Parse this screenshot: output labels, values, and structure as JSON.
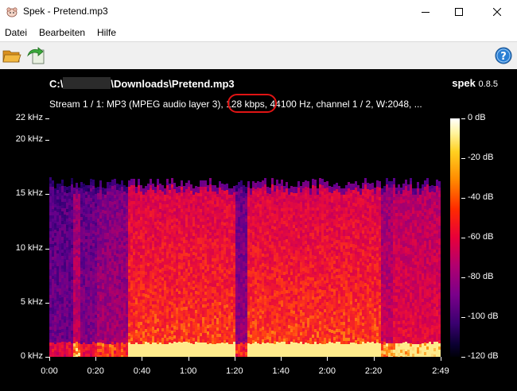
{
  "window": {
    "title": "Spek - Pretend.mp3",
    "icons": {
      "app": "spek-app-icon",
      "minimize": "minimize-icon",
      "maximize": "maximize-icon",
      "close": "close-icon"
    }
  },
  "menu": {
    "items": [
      {
        "label": "Datei"
      },
      {
        "label": "Bearbeiten"
      },
      {
        "label": "Hilfe"
      }
    ]
  },
  "toolbar": {
    "open_icon": "folder-open-icon",
    "save_icon": "save-image-icon",
    "help_icon": "help-icon"
  },
  "viewer": {
    "path_prefix": "C:\\",
    "path_suffix": "\\Downloads\\Pretend.mp3",
    "brand_name": "spek",
    "brand_version": "0.8.5",
    "stream_before": "Stream 1 / 1: MP3 (MPEG audio layer 3), ",
    "stream_bitrate": "128 kbps",
    "stream_after": ", 44100 Hz, channel 1 / 2, W:2048, ...",
    "highlight_color": "#e01414"
  },
  "chart_data": {
    "type": "heatmap",
    "title": "",
    "y_axis": {
      "ticks": [
        "22 kHz",
        "20 kHz",
        "15 kHz",
        "10 kHz",
        "5 kHz",
        "0 kHz"
      ],
      "tick_values": [
        22,
        20,
        15,
        10,
        5,
        0
      ],
      "range": [
        0,
        22
      ],
      "unit": "kHz"
    },
    "x_axis": {
      "ticks": [
        "0:00",
        "0:20",
        "0:40",
        "1:00",
        "1:20",
        "1:40",
        "2:00",
        "2:20",
        "2:49"
      ],
      "tick_values": [
        0,
        20,
        40,
        60,
        80,
        100,
        120,
        140,
        169
      ],
      "range": [
        0,
        169
      ],
      "unit": "s"
    },
    "colorbar": {
      "ticks": [
        "0 dB",
        "-20 dB",
        "-40 dB",
        "-60 dB",
        "-80 dB",
        "-100 dB",
        "-120 dB"
      ],
      "tick_values": [
        0,
        -20,
        -40,
        -60,
        -80,
        -100,
        -120
      ],
      "range": [
        -120,
        0
      ]
    },
    "frequency_cutoff_khz": 16,
    "segments": [
      {
        "start": 0,
        "end": 10,
        "level": 0.35
      },
      {
        "start": 10,
        "end": 13,
        "level": 0.6
      },
      {
        "start": 13,
        "end": 20,
        "level": 0.4
      },
      {
        "start": 20,
        "end": 33,
        "level": 0.5
      },
      {
        "start": 33,
        "end": 80,
        "level": 0.85
      },
      {
        "start": 80,
        "end": 85,
        "level": 0.45
      },
      {
        "start": 85,
        "end": 143,
        "level": 0.85
      },
      {
        "start": 143,
        "end": 148,
        "level": 0.6
      },
      {
        "start": 148,
        "end": 169,
        "level": 0.7
      }
    ]
  }
}
